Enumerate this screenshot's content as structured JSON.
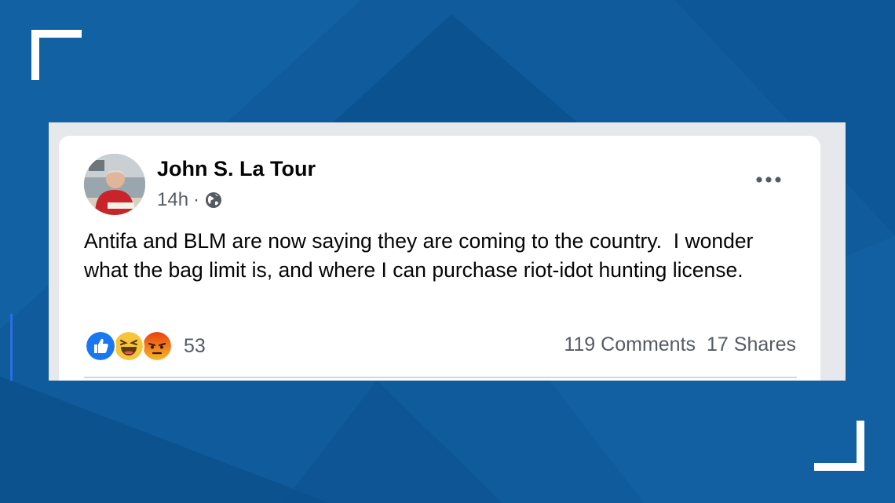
{
  "post": {
    "author": "John S. La Tour",
    "time": "14h",
    "separator": "·",
    "privacy_icon": "globe-icon",
    "text": "Antifa and BLM are now saying they are coming to the country.  I wonder what the bag limit is, and where I can purchase riot-idot hunting license.",
    "reaction_icons": [
      "like-icon",
      "haha-icon",
      "angry-icon"
    ],
    "reaction_count": "53",
    "comments": "119 Comments",
    "shares": "17 Shares",
    "more_icon": "more-options-icon"
  },
  "colors": {
    "background": "#0e5a9a",
    "frame": "#e7e8ec",
    "card": "#ffffff",
    "accent_bar": "#2d6fe0",
    "like_blue": "#1877f2",
    "haha_yellow": "#f7c43b",
    "angry_orange": "#e9710f"
  }
}
